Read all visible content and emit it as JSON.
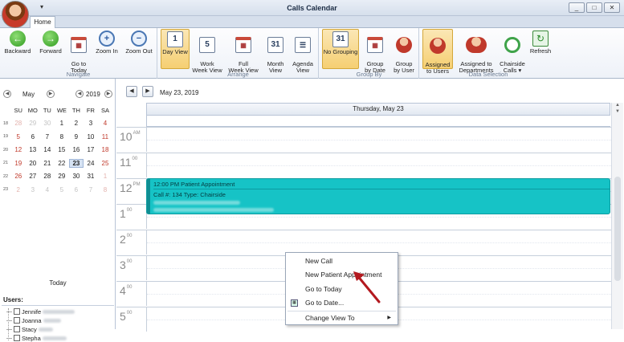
{
  "window": {
    "title": "Calls Calendar",
    "qat_glyph": "▾",
    "buttons": [
      "_",
      "□",
      "✕"
    ]
  },
  "ribbon": {
    "tab": "Home",
    "groups": [
      {
        "name": "Navigate",
        "buttons": [
          "Backward",
          "Forward",
          "Go to\nToday",
          "Zoom In",
          "Zoom Out"
        ]
      },
      {
        "name": "Arrange",
        "buttons": [
          "Day View",
          "Work\nWeek View",
          "Full\nWeek View",
          "Month\nView",
          "Agenda\nView"
        ]
      },
      {
        "name": "Group By",
        "buttons": [
          "No Grouping",
          "Group\nby Date",
          "Group\nby User"
        ]
      },
      {
        "name": "Data Selection",
        "buttons": [
          "Assigned\nto Users",
          "Assigned to\nDepartments",
          "Chairside\nCalls ▾",
          "Refresh"
        ]
      }
    ],
    "icons": {
      "workweek_day": "5",
      "month_day": "31",
      "nogroup_day": "31"
    }
  },
  "minicalendar": {
    "month": "May",
    "year": "2019",
    "prev": "◀",
    "next": "▶",
    "days_of_week": [
      "SU",
      "MO",
      "TU",
      "WE",
      "TH",
      "FR",
      "SA"
    ],
    "weeks": [
      {
        "wk": "18",
        "days": [
          "28",
          "29",
          "30",
          "1",
          "2",
          "3",
          "4"
        ]
      },
      {
        "wk": "19",
        "days": [
          "5",
          "6",
          "7",
          "8",
          "9",
          "10",
          "11"
        ]
      },
      {
        "wk": "20",
        "days": [
          "12",
          "13",
          "14",
          "15",
          "16",
          "17",
          "18"
        ]
      },
      {
        "wk": "21",
        "days": [
          "19",
          "20",
          "21",
          "22",
          "23",
          "24",
          "25"
        ]
      },
      {
        "wk": "22",
        "days": [
          "26",
          "27",
          "28",
          "29",
          "30",
          "31",
          "1"
        ]
      },
      {
        "wk": "23",
        "days": [
          "2",
          "3",
          "4",
          "5",
          "6",
          "7",
          "8"
        ]
      }
    ],
    "selected_day": "23",
    "today_label": "Today"
  },
  "users": {
    "header": "Users:",
    "items": [
      "Jennife",
      "Joanna",
      "Stacy",
      "Stepha"
    ]
  },
  "scheduler": {
    "current_date": "May 23, 2019",
    "day_header": "Thursday, May 23",
    "hours": [
      {
        "h": "10",
        "s": "AM"
      },
      {
        "h": "11",
        "s": "00"
      },
      {
        "h": "12",
        "s": "PM"
      },
      {
        "h": "1",
        "s": "00"
      },
      {
        "h": "2",
        "s": "00"
      },
      {
        "h": "3",
        "s": "00"
      },
      {
        "h": "4",
        "s": "00"
      },
      {
        "h": "5",
        "s": "00"
      }
    ],
    "appointment": {
      "title": "12:00 PM Patient Appointment",
      "line2": "Call #: 134 Type: Chairside",
      "color": "#16c3c6"
    }
  },
  "context_menu": {
    "items": [
      "New Call",
      "New Patient Appointment",
      "Go to Today",
      "Go to Date...",
      "Change View To"
    ]
  }
}
